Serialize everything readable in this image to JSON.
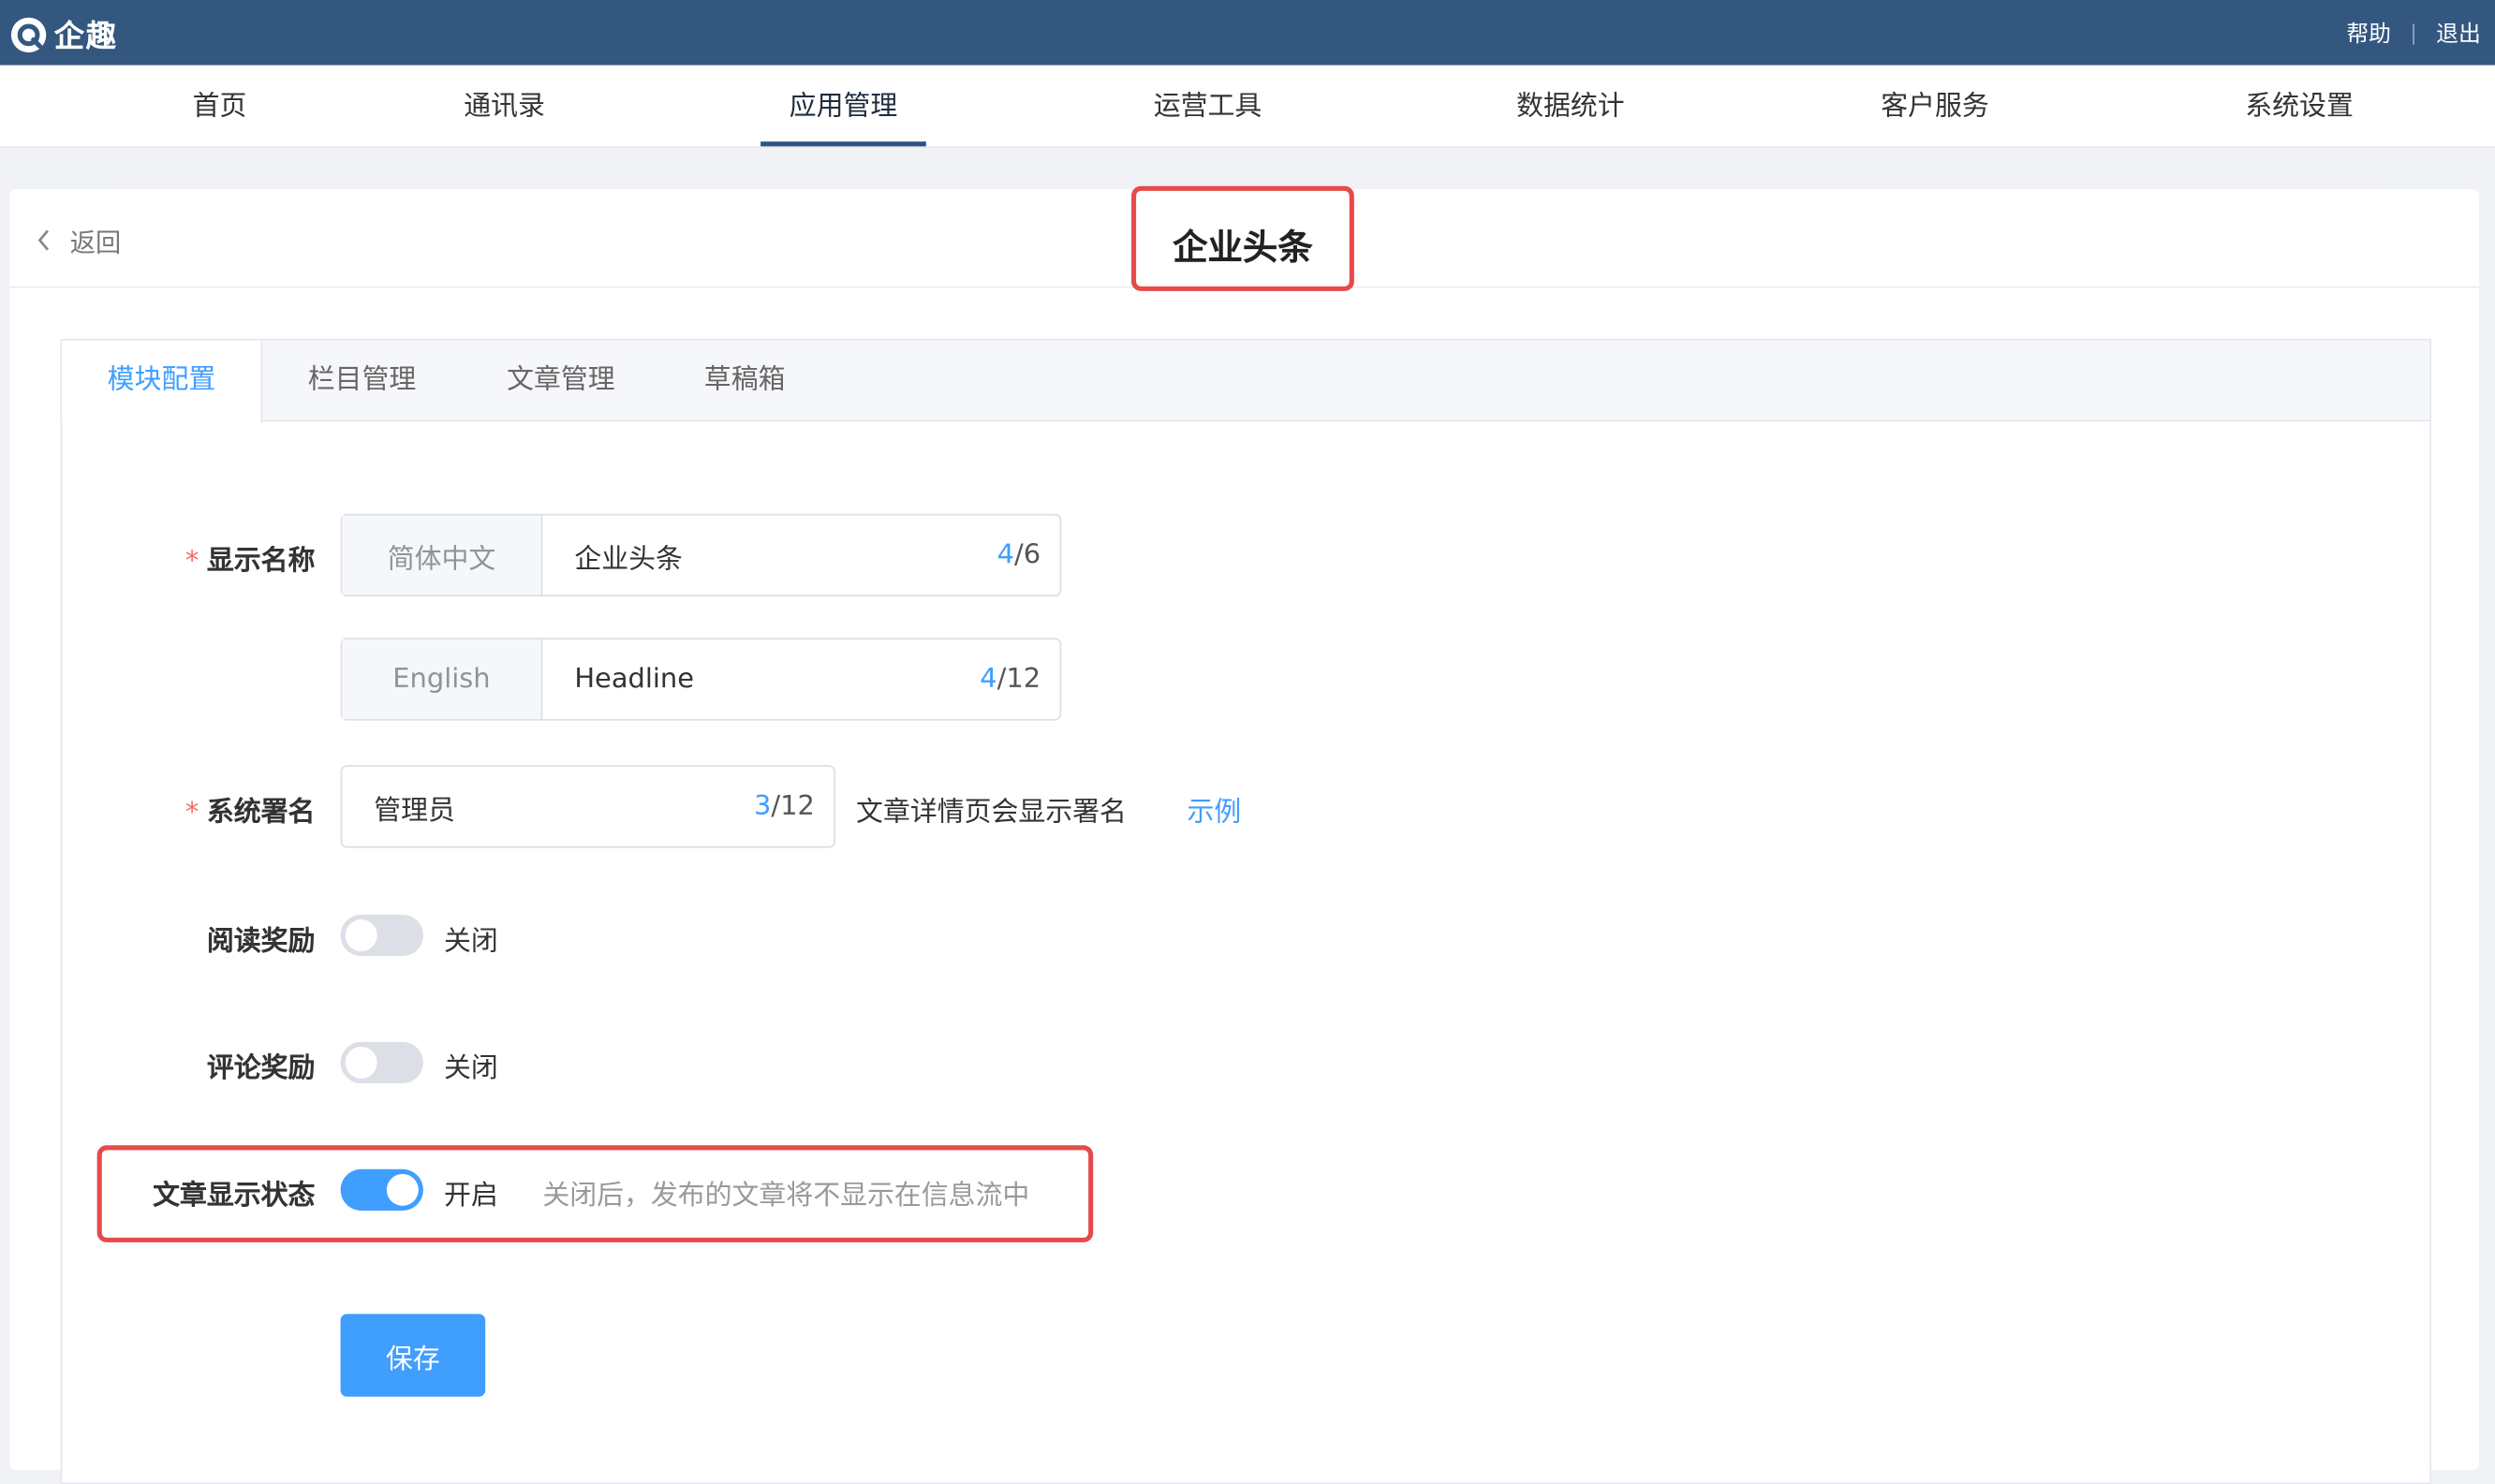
{
  "app": {
    "logo_text": "企趣"
  },
  "topbar": {
    "help": "帮助",
    "separator": "|",
    "logout": "退出"
  },
  "nav": {
    "items": [
      "首页",
      "通讯录",
      "应用管理",
      "运营工具",
      "数据统计",
      "客户服务",
      "系统设置"
    ],
    "active": "应用管理"
  },
  "header": {
    "back": "返回",
    "title": "企业头条"
  },
  "tabs": {
    "items": [
      "模块配置",
      "栏目管理",
      "文章管理",
      "草稿箱"
    ],
    "active": "模块配置"
  },
  "form": {
    "display_name": {
      "label": "显示名称",
      "zh": {
        "lang": "简体中文",
        "value": "企业头条",
        "count_current": "4",
        "count_max": "/6"
      },
      "en": {
        "lang": "English",
        "value": "Headline",
        "count_current": "4",
        "count_max": "/12"
      }
    },
    "signature": {
      "label": "系统署名",
      "value": "管理员",
      "count_current": "3",
      "count_max": "/12",
      "note": "文章详情页会显示署名",
      "example_link": "示例"
    },
    "read_reward": {
      "label": "阅读奖励",
      "state_text": "关闭",
      "on": false
    },
    "comment_reward": {
      "label": "评论奖励",
      "state_text": "关闭",
      "on": false
    },
    "article_display": {
      "label": "文章显示状态",
      "state_text": "开启",
      "on": true,
      "hint": "关闭后，发布的文章将不显示在信息流中"
    },
    "save_button": "保存"
  },
  "colors": {
    "topbar": "#33577f",
    "primary": "#409eff",
    "highlight": "#e64a4a"
  }
}
